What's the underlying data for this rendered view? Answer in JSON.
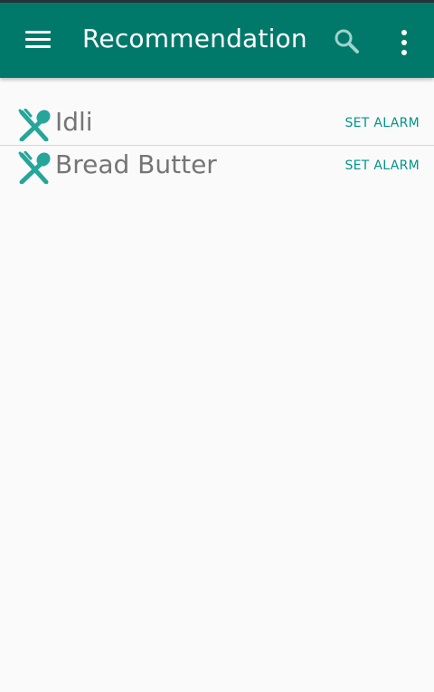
{
  "toolbar": {
    "title": "Recommendation",
    "background_color": "#00796b",
    "menu_icon": "hamburger-menu-icon",
    "search_icon": "search-icon",
    "overflow_icon": "more-vert-icon"
  },
  "recommendations": [
    {
      "name": "Idli",
      "icon": "fork-spoon-icon",
      "action_label": "SET ALARM"
    },
    {
      "name": "Bread Butter",
      "icon": "fork-spoon-icon",
      "action_label": "SET ALARM"
    }
  ],
  "colors": {
    "accent": "#009688",
    "item_text": "#757575",
    "page_background": "#fafafa"
  }
}
